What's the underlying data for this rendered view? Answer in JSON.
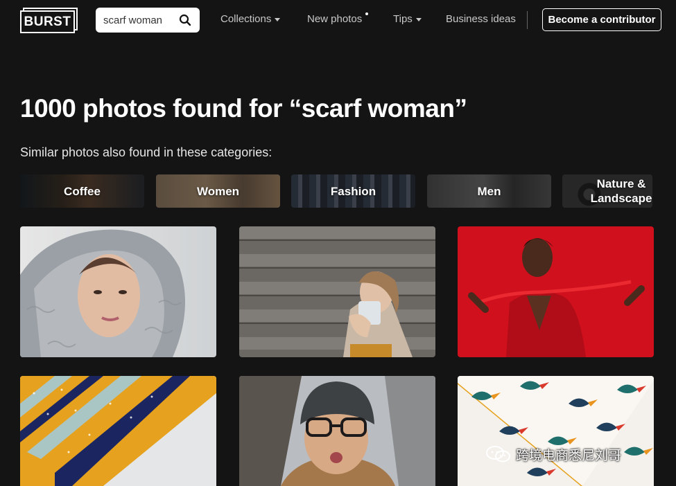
{
  "header": {
    "logo_text": "BURST",
    "search_value": "scarf woman",
    "nav": [
      {
        "label": "Collections",
        "has_caret": true
      },
      {
        "label": "New photos",
        "has_dot": true
      },
      {
        "label": "Tips",
        "has_caret": true
      },
      {
        "label": "Business ideas"
      }
    ],
    "contributor_label": "Become a contributor"
  },
  "results": {
    "title": "1000 photos found for “scarf woman”",
    "similar_label": "Similar photos also found in these categories:"
  },
  "categories": [
    {
      "label": "Coffee"
    },
    {
      "label": "Women"
    },
    {
      "label": "Fashion"
    },
    {
      "label": "Men"
    },
    {
      "label": "Nature & Landscape"
    }
  ],
  "photos": [
    {
      "subject": "woman in grey knit hood scarf"
    },
    {
      "subject": "woman with mug against wooden wall"
    },
    {
      "subject": "woman with red scarf on red background"
    },
    {
      "subject": "striped orange navy patterned scarf"
    },
    {
      "subject": "woman in knit beanie and glasses"
    },
    {
      "subject": "toucan print scarf"
    }
  ],
  "watermark": "跨境电商悉尼刘哥",
  "colors": {
    "background": "#141414",
    "accent_red": "#d0101d"
  }
}
